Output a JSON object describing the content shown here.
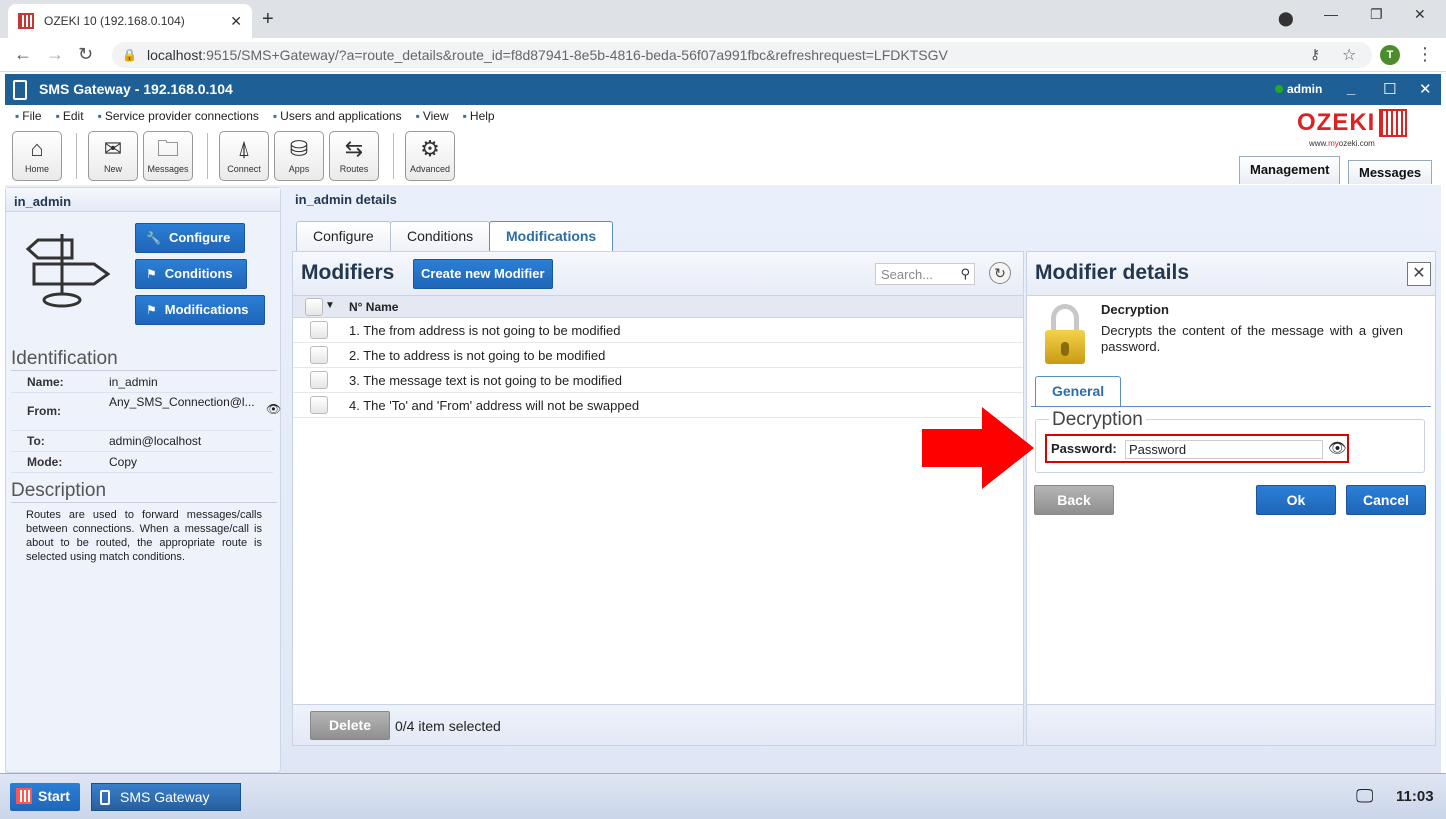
{
  "browser": {
    "tab_title": "OZEKI 10 (192.168.0.104)",
    "url_host": "localhost",
    "url_path": ":9515/SMS+Gateway/?a=route_details&route_id=f8d87941-8e5b-4816-beda-56f07a991fbc&refreshrequest=LFDKTSGV",
    "profile_initial": "T"
  },
  "app": {
    "title": "SMS Gateway - 192.168.0.104",
    "user": "admin",
    "menu": [
      "File",
      "Edit",
      "Service provider connections",
      "Users and applications",
      "View",
      "Help"
    ],
    "toolbar": [
      {
        "label": "Home",
        "icon": "home-icon"
      },
      {
        "label": "New",
        "icon": "new-message-icon"
      },
      {
        "label": "Messages",
        "icon": "folder-icon"
      },
      {
        "label": "Connect",
        "icon": "antenna-icon"
      },
      {
        "label": "Apps",
        "icon": "database-icon"
      },
      {
        "label": "Routes",
        "icon": "signpost-icon"
      },
      {
        "label": "Advanced",
        "icon": "gear-icon"
      }
    ],
    "logo": {
      "text": "OZEKI",
      "site_prefix": "www.",
      "site_brand": "my",
      "site_suffix": "ozeki.com"
    },
    "top_tabs": [
      "Management",
      "Messages"
    ]
  },
  "left": {
    "header": "in_admin",
    "buttons": [
      "Configure",
      "Conditions",
      "Modifications"
    ],
    "identification_title": "Identification",
    "identification": [
      {
        "key": "Name:",
        "value": "in_admin"
      },
      {
        "key": "From:",
        "value": "Any_SMS_Connection@l..."
      },
      {
        "key": "To:",
        "value": "admin@localhost"
      },
      {
        "key": "Mode:",
        "value": "Copy"
      }
    ],
    "description_title": "Description",
    "description": "Routes are used to forward messages/calls between connections. When a message/call is about to be routed, the appropriate route is selected using match conditions."
  },
  "main": {
    "header": "in_admin details",
    "tabs": [
      "Configure",
      "Conditions",
      "Modifications"
    ],
    "active_tab": "Modifications",
    "modifiers": {
      "title": "Modifiers",
      "create_button": "Create new Modifier",
      "search_placeholder": "Search...",
      "column": "N° Name",
      "rows": [
        "1. The from address is not going to be modified",
        "2. The to address is not going to be modified",
        "3. The message text is not going to be modified",
        "4. The 'To' and 'From' address will not be swapped"
      ],
      "delete_button": "Delete",
      "selection_status": "0/4 item selected"
    },
    "details": {
      "title": "Modifier details",
      "name": "Decryption",
      "description": "Decrypts the content of the message with a given password.",
      "tab": "General",
      "group_title": "Decryption",
      "password_label": "Password:",
      "password_value": "Password",
      "back_button": "Back",
      "ok_button": "Ok",
      "cancel_button": "Cancel"
    }
  },
  "taskbar": {
    "start": "Start",
    "item": "SMS Gateway",
    "clock": "11:03"
  },
  "colors": {
    "app_header": "#1e5f96",
    "button_blue": "#1f66b8",
    "highlight_red": "#d00000",
    "logo_red": "#dd2222"
  }
}
